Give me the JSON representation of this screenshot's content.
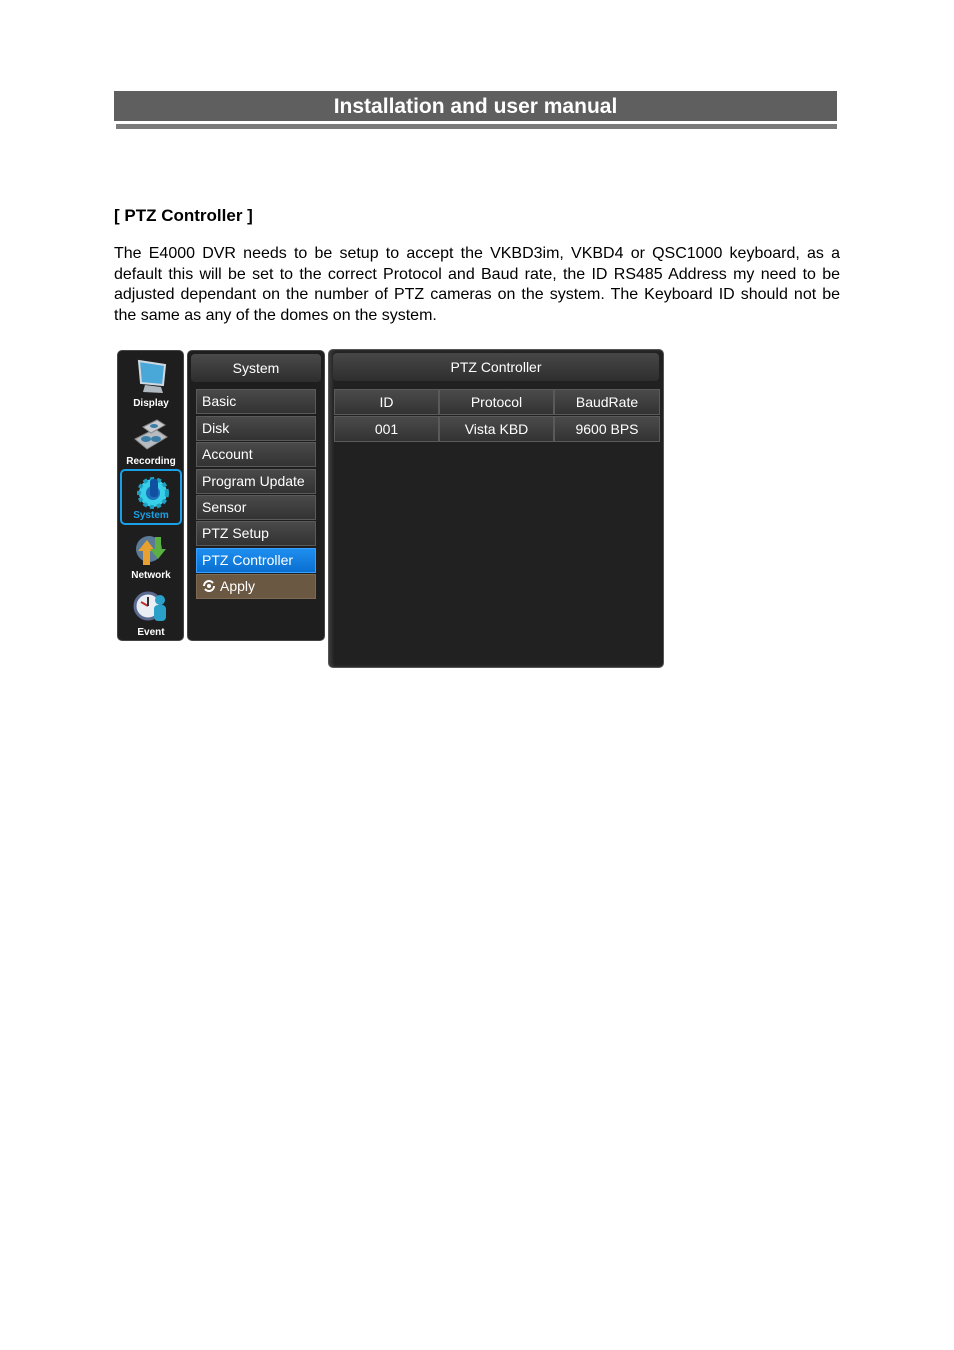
{
  "header": {
    "title": "Installation and user manual"
  },
  "section": {
    "title": "[ PTZ Controller ]",
    "body": "The E4000 DVR needs to be setup to accept the VKBD3im, VKBD4 or QSC1000 keyboard, as a default this will be set to the correct Protocol and Baud rate, the ID RS485 Address my need to be adjusted dependant on the number of PTZ cameras on the system. The Keyboard ID should not be the same as any of the domes on the system."
  },
  "dvr": {
    "icon_menu": [
      {
        "label": "Display",
        "icon": "monitor-icon"
      },
      {
        "label": "Recording",
        "icon": "recording-disks-icon"
      },
      {
        "label": "System",
        "icon": "gear-icon",
        "active": true
      },
      {
        "label": "Network",
        "icon": "network-arrows-icon"
      },
      {
        "label": "Event",
        "icon": "clock-person-icon"
      }
    ],
    "menu": {
      "title": "System",
      "items": [
        {
          "label": "Basic"
        },
        {
          "label": "Disk"
        },
        {
          "label": "Account"
        },
        {
          "label": "Program Update"
        },
        {
          "label": "Sensor"
        },
        {
          "label": "PTZ Setup"
        },
        {
          "label": "PTZ Controller",
          "selected": true
        },
        {
          "label": "Apply",
          "icon": "apply-refresh-icon"
        }
      ]
    },
    "content": {
      "title": "PTZ Controller",
      "columns": [
        "ID",
        "Protocol",
        "BaudRate"
      ],
      "rows": [
        [
          "001",
          "Vista KBD",
          "9600 BPS"
        ]
      ]
    },
    "colors": {
      "accent": "#1a8ff0",
      "apply": "#6b5842",
      "panel": "#212121"
    }
  }
}
